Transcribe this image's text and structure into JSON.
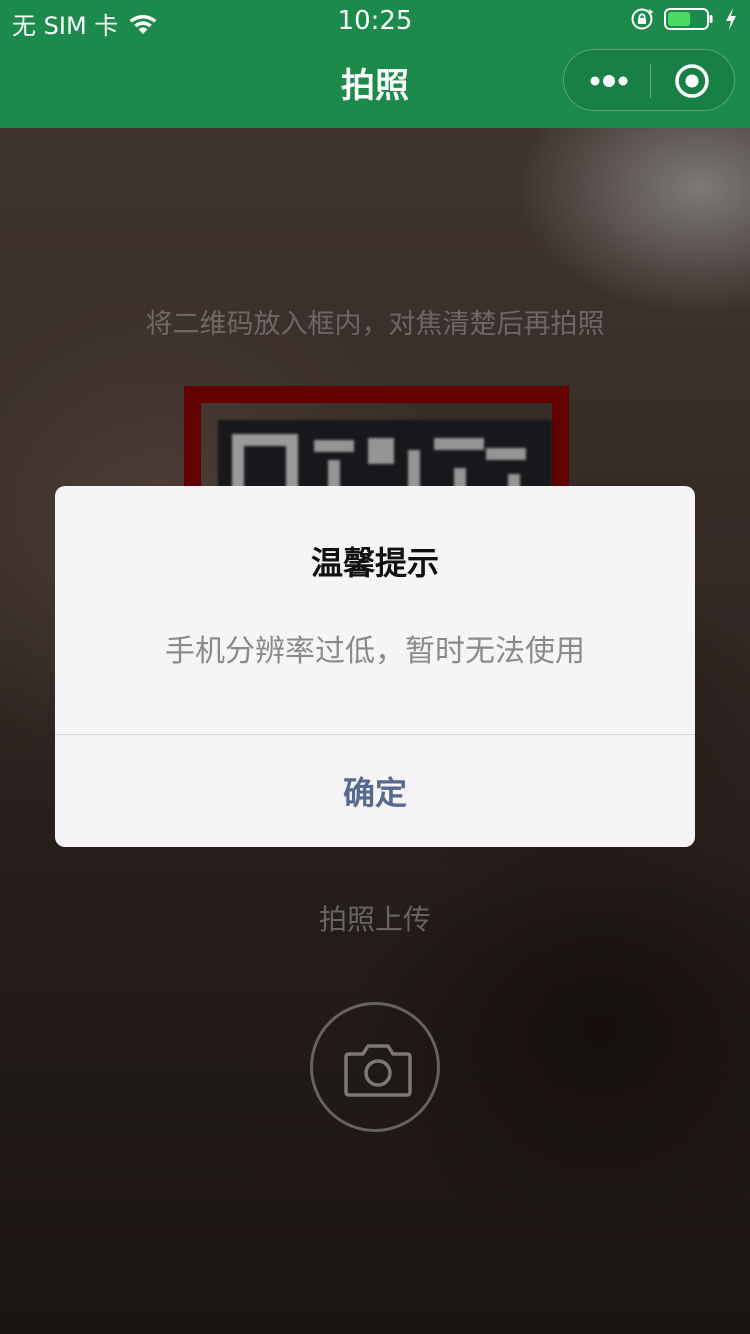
{
  "status_bar": {
    "carrier": "无 SIM 卡",
    "time": "10:25",
    "battery_level": 0.6
  },
  "nav": {
    "title": "拍照"
  },
  "camera": {
    "hint": "将二维码放入框内，对焦清楚后再拍照",
    "upload_label": "拍照上传"
  },
  "dialog": {
    "title": "温馨提示",
    "message": "手机分辨率过低，暂时无法使用",
    "confirm_label": "确定"
  },
  "colors": {
    "nav_bar": "#1b8a4b",
    "frame": "#8a0000",
    "dialog_button": "#56698f"
  },
  "icons": [
    "wifi-icon",
    "orientation-lock-icon",
    "battery-icon",
    "charging-bolt-icon",
    "more-icon",
    "target-icon",
    "camera-icon"
  ]
}
